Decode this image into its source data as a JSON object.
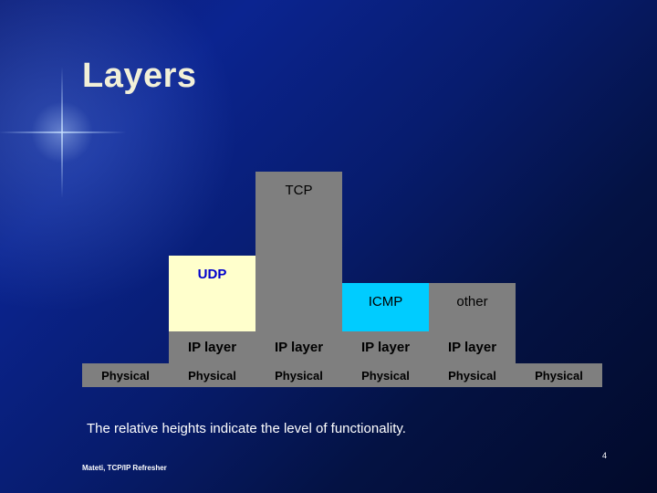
{
  "slide": {
    "title": "Layers",
    "caption": "The relative heights indicate the level of functionality.",
    "footer": "Mateti, TCP/IP Refresher",
    "page_number": "4",
    "colors": {
      "gray_block": "#7f7f7f",
      "udp_block": "#ffffcc",
      "icmp_block": "#00ccff",
      "udp_text": "#0000cc",
      "title_text": "#f2f0d8",
      "background_start": "#0d1f7a",
      "background_end": "#020a2a"
    }
  },
  "diagram": {
    "blocks": [
      {
        "label": "TCP"
      },
      {
        "label": "UDP"
      },
      {
        "label": "ICMP"
      },
      {
        "label": "other"
      }
    ],
    "ip_layer": [
      {
        "label": "IP layer"
      },
      {
        "label": "IP layer"
      },
      {
        "label": "IP layer"
      },
      {
        "label": "IP layer"
      }
    ],
    "physical": [
      {
        "label": "Physical"
      },
      {
        "label": "Physical"
      },
      {
        "label": "Physical"
      },
      {
        "label": "Physical"
      },
      {
        "label": "Physical"
      },
      {
        "label": "Physical"
      }
    ]
  }
}
